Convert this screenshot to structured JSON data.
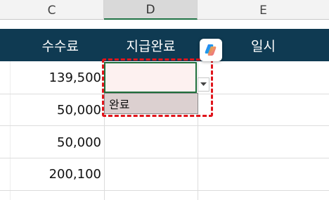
{
  "columns": {
    "c": "C",
    "d": "D",
    "e": "E"
  },
  "header_row": {
    "fee": "수수료",
    "payment_status": "지급완료",
    "date": "일시"
  },
  "fee_values": [
    "139,500",
    "50,000",
    "50,000",
    "200,100"
  ],
  "dropdown": {
    "options": [
      "완료"
    ]
  },
  "colors": {
    "header_bg": "#0f3a52",
    "highlight_border": "#e0141b",
    "active_cell_border": "#1f6f3b"
  },
  "icons": {
    "copilot": "copilot-icon",
    "dropdown": "chevron-down-icon"
  }
}
